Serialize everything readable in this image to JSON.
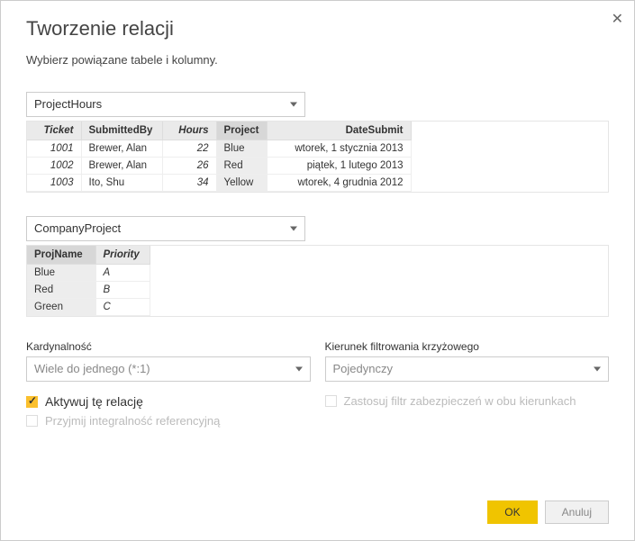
{
  "dialog": {
    "title": "Tworzenie relacji",
    "subtitle": "Wybierz powiązane tabele i kolumny."
  },
  "table1": {
    "selector": "ProjectHours",
    "headers": [
      "Ticket",
      "SubmittedBy",
      "Hours",
      "Project",
      "DateSubmit"
    ],
    "rows": [
      {
        "ticket": "1001",
        "by": "Brewer, Alan",
        "hours": "22",
        "project": "Blue",
        "date": "wtorek, 1 stycznia 2013"
      },
      {
        "ticket": "1002",
        "by": "Brewer, Alan",
        "hours": "26",
        "project": "Red",
        "date": "piątek, 1 lutego 2013"
      },
      {
        "ticket": "1003",
        "by": "Ito, Shu",
        "hours": "34",
        "project": "Yellow",
        "date": "wtorek, 4 grudnia 2012"
      }
    ]
  },
  "table2": {
    "selector": "CompanyProject",
    "headers": [
      "ProjName",
      "Priority"
    ],
    "rows": [
      {
        "name": "Blue",
        "priority": "A"
      },
      {
        "name": "Red",
        "priority": "B"
      },
      {
        "name": "Green",
        "priority": "C"
      }
    ]
  },
  "cardinality": {
    "label": "Kardynalność",
    "value": "Wiele do jednego (*:1)"
  },
  "crossfilter": {
    "label": "Kierunek filtrowania krzyżowego",
    "value": "Pojedynczy"
  },
  "checks": {
    "activate": "Aktywuj tę relację",
    "integrity": "Przyjmij integralność referencyjną",
    "security": "Zastosuj filtr zabezpieczeń w obu kierunkach"
  },
  "buttons": {
    "ok": "OK",
    "cancel": "Anuluj"
  }
}
